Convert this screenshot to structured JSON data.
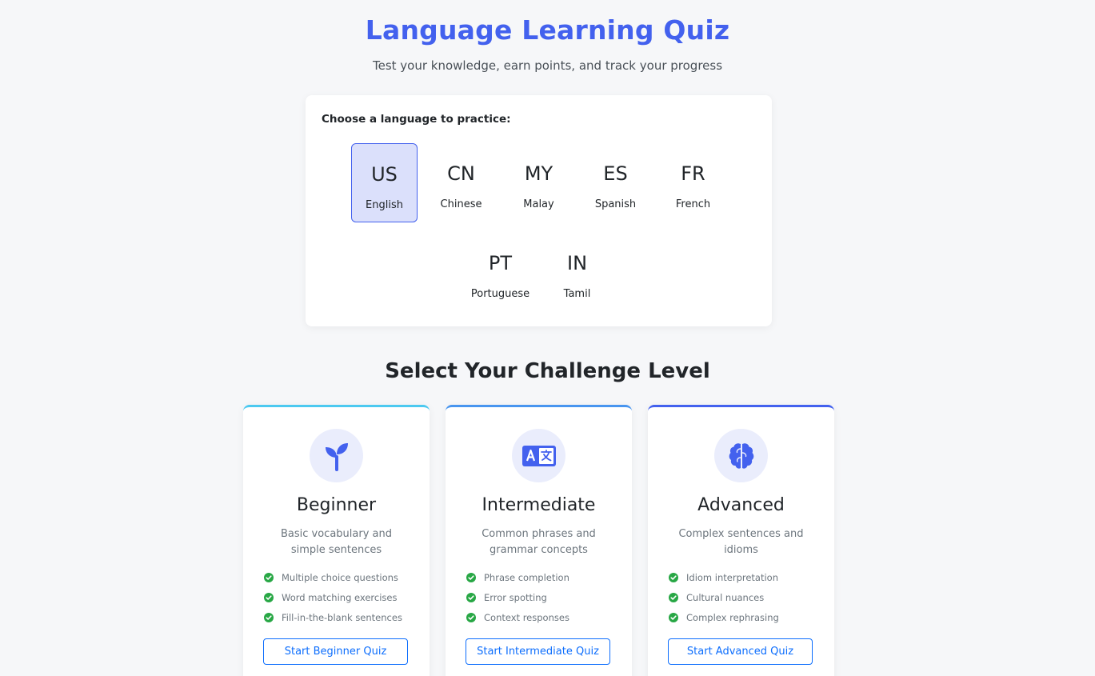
{
  "header": {
    "title": "Language Learning Quiz",
    "subtitle": "Test your knowledge, earn points, and track your progress"
  },
  "language_picker": {
    "prompt": "Choose a language to practice:",
    "selected": "English",
    "languages": [
      {
        "code": "US",
        "name": "English"
      },
      {
        "code": "CN",
        "name": "Chinese"
      },
      {
        "code": "MY",
        "name": "Malay"
      },
      {
        "code": "ES",
        "name": "Spanish"
      },
      {
        "code": "FR",
        "name": "French"
      },
      {
        "code": "PT",
        "name": "Portuguese"
      },
      {
        "code": "IN",
        "name": "Tamil"
      }
    ]
  },
  "levels_section": {
    "title": "Select Your Challenge Level",
    "levels": [
      {
        "icon": "seedling-icon",
        "name": "Beginner",
        "description": "Basic vocabulary and simple sentences",
        "features": [
          "Multiple choice questions",
          "Word matching exercises",
          "Fill-in-the-blank sentences"
        ],
        "button": "Start Beginner Quiz",
        "accent": "#4cc9f0"
      },
      {
        "icon": "language-icon",
        "name": "Intermediate",
        "description": "Common phrases and grammar concepts",
        "features": [
          "Phrase completion",
          "Error spotting",
          "Context responses"
        ],
        "button": "Start Intermediate Quiz",
        "accent": "#4895ef"
      },
      {
        "icon": "brain-icon",
        "name": "Advanced",
        "description": "Complex sentences and idioms",
        "features": [
          "Idiom interpretation",
          "Cultural nuances",
          "Complex rephrasing"
        ],
        "button": "Start Advanced Quiz",
        "accent": "#4361ee"
      }
    ]
  },
  "colors": {
    "primary": "#4361ee",
    "selected_bg": "#dbe0fb",
    "check": "#28a745",
    "button": "#0d6efd"
  }
}
